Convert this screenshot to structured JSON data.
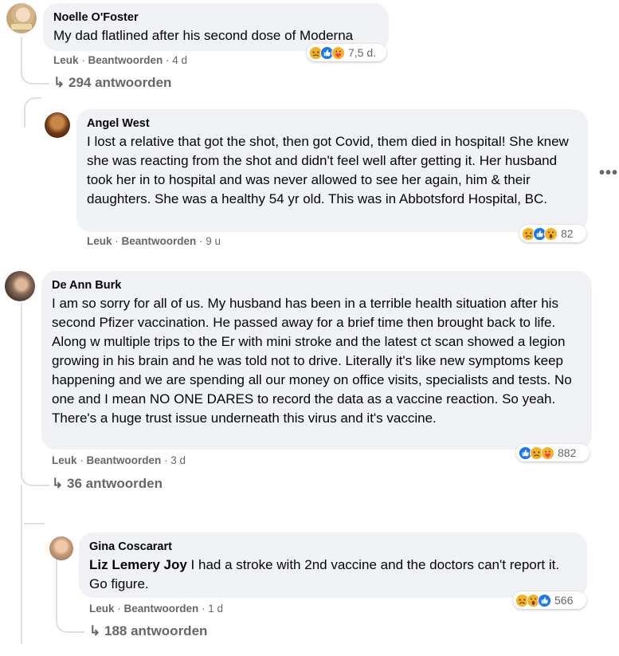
{
  "comments": [
    {
      "author": "Noelle O'Foster",
      "text": "My dad flatlined after his second dose of Moderna",
      "like": "Leuk",
      "reply": "Beantwoorden",
      "time": "4 d",
      "reaction_count": "7,5 d.",
      "reaction_icons": [
        "sad-icon",
        "like-icon",
        "care-icon"
      ],
      "replies_link": "294 antwoorden"
    },
    {
      "author": "Angel West",
      "text": "I lost a relative that got the shot, then got Covid, them died in hospital! She knew she was reacting from the shot and didn't feel well after getting it. Her husband took her in to hospital and was never allowed to see her again, him & their daughters. She was a healthy 54 yr old. This was in Abbotsford Hospital, BC.",
      "like": "Leuk",
      "reply": "Beantwoorden",
      "time": "9 u",
      "reaction_count": "82",
      "reaction_icons": [
        "sad-icon",
        "like-icon",
        "wow-icon"
      ]
    },
    {
      "author": "De Ann Burk",
      "text": "I am so sorry for all of us. My husband has been in a terrible health situation after his second Pfizer vaccination. He passed away for a brief time then brought back to life. Along w multiple trips to the Er with mini stroke and the latest ct scan showed a legion growing in his brain and he was told not to drive. Literally it's like new symptoms keep happening and we are spending all our money on office visits, specialists and tests. No one and I mean NO ONE DARES to record the data as a vaccine reaction. So yeah. There's a huge trust issue underneath this virus and it's vaccine.",
      "like": "Leuk",
      "reply": "Beantwoorden",
      "time": "3 d",
      "reaction_count": "882",
      "reaction_icons": [
        "like-icon",
        "sad-icon",
        "care-icon"
      ],
      "replies_link": "36 antwoorden"
    },
    {
      "author": "Gina Coscarart",
      "mention": "Liz Lemery Joy",
      "text": " I had a stroke with 2nd vaccine and the doctors can't report it. Go figure.",
      "like": "Leuk",
      "reply": "Beantwoorden",
      "time": "1 d",
      "reaction_count": "566",
      "reaction_icons": [
        "sad-icon",
        "wow-icon",
        "like-icon"
      ],
      "replies_link": "188 antwoorden"
    }
  ],
  "separator": " · ",
  "more_options": "•••",
  "reply_arrow": "↳",
  "colors": {
    "bubble": "#f0f2f5",
    "meta": "#65676b",
    "like_blue": "#1877f2",
    "emoji_yellow": "#f7b125",
    "care_red": "#f33e58"
  }
}
